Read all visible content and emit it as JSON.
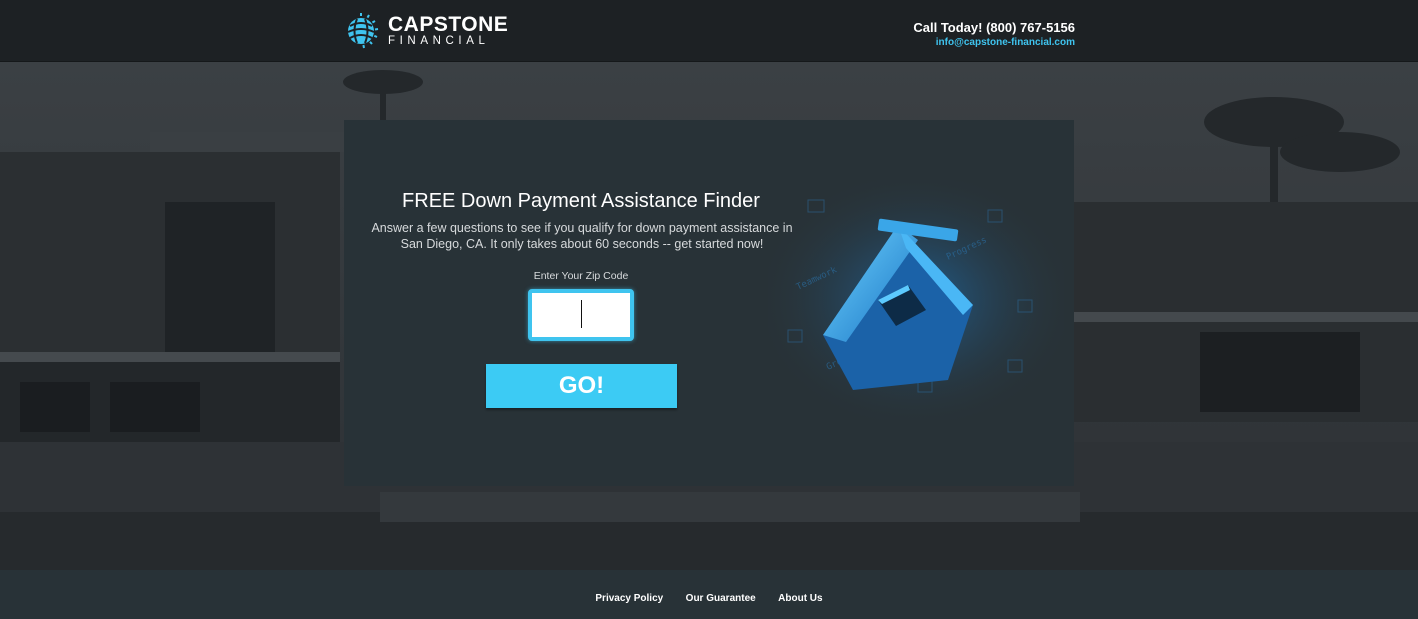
{
  "header": {
    "brand": "CAPSTONE",
    "brand_sub": "FINANCIAL",
    "phone": "Call Today! (800) 767-5156",
    "email": "info@capstone-financial.com"
  },
  "card": {
    "title": "FREE Down Payment Assistance Finder",
    "description": "Answer a few questions to see if you qualify for down payment assistance in San Diego, CA. It only takes about 60 seconds -- get started now!",
    "zip_label": "Enter Your Zip Code",
    "zip_value": "",
    "go_label": "GO!"
  },
  "footer": {
    "links": [
      "Privacy Policy",
      "Our Guarantee",
      "About Us"
    ]
  },
  "colors": {
    "accent": "#3ccbf4",
    "header_bg": "#1d2124",
    "card_bg": "#283237"
  },
  "icons": [
    "globe-logo-icon",
    "house-illustration"
  ]
}
